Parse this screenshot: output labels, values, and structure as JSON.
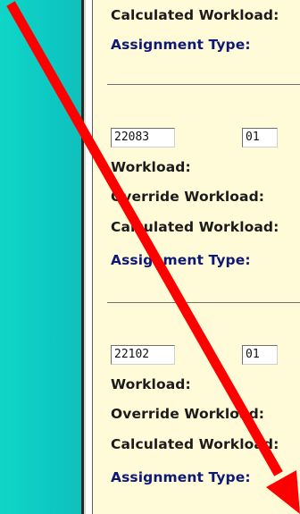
{
  "labels": {
    "workload": "Workload:",
    "override": "Override Workload:",
    "calculated": "Calculated Workload:",
    "assignment_type": "Assignment Type:"
  },
  "records": [
    {
      "course": "",
      "section": ""
    },
    {
      "course": "22083",
      "section": "01"
    },
    {
      "course": "22102",
      "section": "01"
    }
  ],
  "colors": {
    "sidebar": "#0fd6c7",
    "panel_bg": "#fffbd8",
    "assignment_label": "#0e1875",
    "arrow": "#ff0000"
  }
}
